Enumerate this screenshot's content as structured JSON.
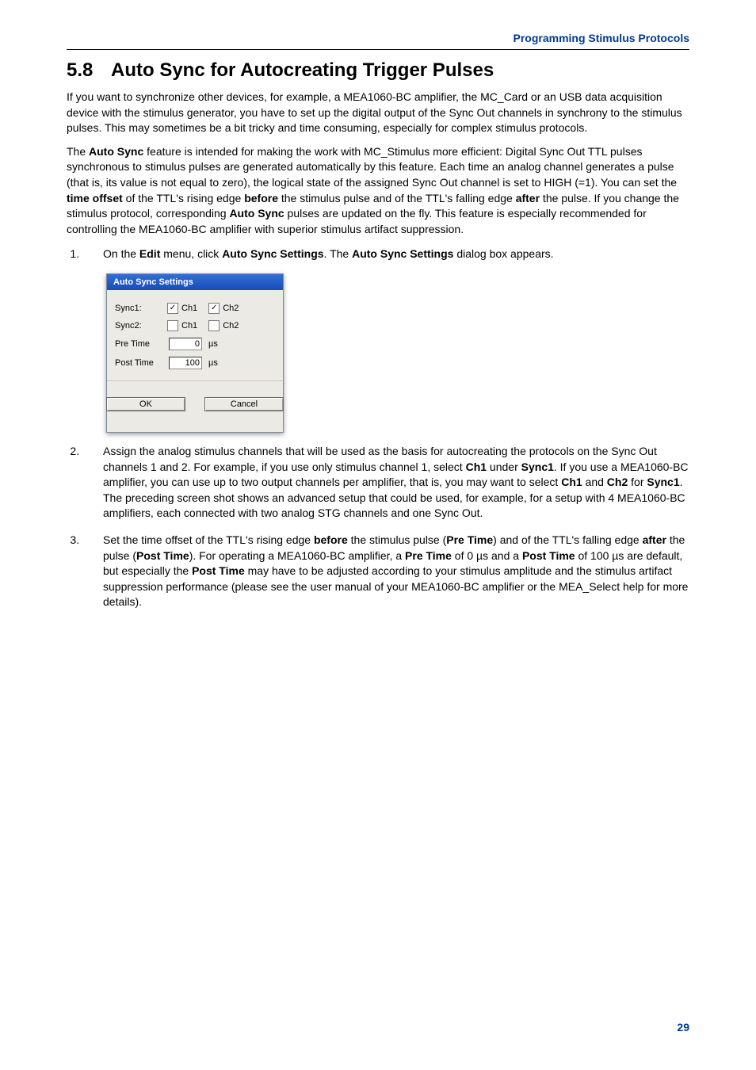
{
  "running_head": "Programming Stimulus Protocols",
  "section": {
    "number": "5.8",
    "title": "Auto Sync for Autocreating Trigger Pulses"
  },
  "intro1": "If you want to synchronize other devices, for example, a MEA1060-BC amplifier, the MC_Card or an USB data acquisition device with the stimulus generator, you have to set up the digital output of the Sync Out channels in synchrony to the stimulus pulses. This may sometimes be a bit tricky and time consuming, especially for complex stimulus protocols.",
  "intro2": {
    "s1a": "The ",
    "b1": "Auto Sync",
    "s1b": " feature is intended for making the work with MC_Stimulus more efficient: Digital Sync Out TTL pulses synchronous to stimulus pulses are generated automatically by this feature. Each time an analog channel generates a pulse (that is, its value is not equal to zero), the logical state of the assigned Sync Out channel is set to HIGH (=1). You can set the ",
    "b2": "time offset",
    "s2": " of the TTL's rising edge ",
    "b3": "before",
    "s3": " the stimulus pulse and of the TTL's falling edge ",
    "b4": "after",
    "s4": " the pulse. If you change the stimulus protocol, corresponding ",
    "b5": "Auto Sync",
    "s5": " pulses are updated on the fly. This feature is especially recommended for controlling the MEA1060-BC amplifier with superior stimulus artifact suppression."
  },
  "step1": {
    "a": "On the ",
    "b1": "Edit",
    "b": " menu, click ",
    "b2": "Auto Sync Settings",
    "c": ". The ",
    "b3": "Auto Sync Settings",
    "d": " dialog box appears."
  },
  "dialog": {
    "title": "Auto Sync Settings",
    "sync1_label": "Sync1:",
    "sync2_label": "Sync2:",
    "ch1_label": "Ch1",
    "ch2_label": "Ch2",
    "sync1_ch1_checked": true,
    "sync1_ch2_checked": true,
    "sync2_ch1_checked": false,
    "sync2_ch2_checked": false,
    "pre_label": "Pre Time",
    "post_label": "Post Time",
    "pre_value": "0",
    "post_value": "100",
    "unit": "µs",
    "ok": "OK",
    "cancel": "Cancel"
  },
  "step2": {
    "a": "Assign the analog stimulus channels that will be used as the basis for autocreating the protocols on the Sync Out channels 1 and 2. For example, if you use only stimulus channel 1, select ",
    "b1": "Ch1",
    "b": " under ",
    "b2": "Sync1",
    "c": ". If you use a MEA1060-BC amplifier, you can use up to two output channels per amplifier, that is, you may want to select ",
    "b3": "Ch1",
    "d": " and ",
    "b4": "Ch2",
    "e": " for ",
    "b5": "Sync1",
    "f": ". The preceding screen shot shows an advanced setup that could be used, for example, for a setup with 4 MEA1060-BC amplifiers, each connected with two analog STG channels and one Sync Out."
  },
  "step3": {
    "a": "Set the time offset of the TTL's rising edge ",
    "b1": "before",
    "b": " the stimulus pulse (",
    "b2": "Pre Time",
    "c": ") and of the TTL's falling edge ",
    "b3": "after",
    "d": " the pulse (",
    "b4": "Post Time",
    "e": "). For operating a MEA1060-BC amplifier, a ",
    "b5": "Pre Time",
    "f": " of 0 µs and a ",
    "b6": "Post Time",
    "g": " of 100 µs are default, but especially the ",
    "b7": "Post Time",
    "h": " may have to be adjusted according to your stimulus amplitude and the stimulus artifact suppression performance (please see the user manual of your MEA1060-BC amplifier or the MEA_Select help for more details)."
  },
  "page_number": "29"
}
